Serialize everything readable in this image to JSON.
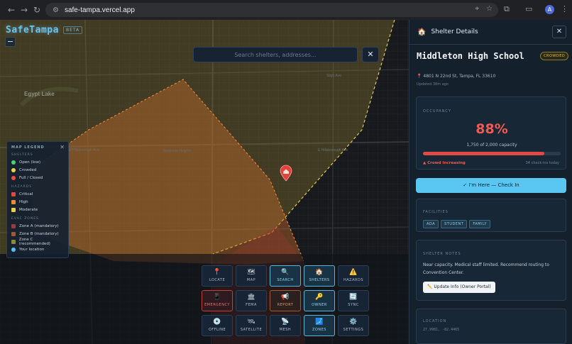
{
  "browser": {
    "url": "safe-tampa.vercel.app",
    "avatar_initial": "A"
  },
  "app": {
    "logo": "SafeTampa",
    "badge": "BETA"
  },
  "search": {
    "placeholder": "Search shelters, addresses...",
    "close": "✕"
  },
  "map": {
    "zoom_out": "−",
    "labels": {
      "egypt_lake": "Egypt Lake",
      "street_1": "W Hillsborough Ave",
      "street_2": "E Hillsborough Ave",
      "street_3": "Seminole Heights",
      "street_4": "Sligh Ave"
    }
  },
  "legend": {
    "title": "MAP LEGEND",
    "close": "✕",
    "shelters_title": "SHELTERS",
    "shelters": [
      {
        "label": "Open (low)",
        "color": "#4cd37a"
      },
      {
        "label": "Crowded",
        "color": "#e6d84a"
      },
      {
        "label": "Full / Closed",
        "color": "#ee4b4b"
      }
    ],
    "hazards_title": "HAZARDS",
    "hazards": [
      {
        "label": "Critical",
        "color": "#e04848"
      },
      {
        "label": "High",
        "color": "#e8893c"
      },
      {
        "label": "Moderate",
        "color": "#e6d24a"
      }
    ],
    "zones_title": "EVAC ZONES",
    "zones": [
      {
        "label": "Zone A (mandatory)",
        "color": "#9a3a3a"
      },
      {
        "label": "Zone B (mandatory)",
        "color": "#9a5a38"
      },
      {
        "label": "Zone C (recommended)",
        "color": "#8c8a3a"
      },
      {
        "label": "Your location",
        "color": "#4fc3f7"
      }
    ]
  },
  "toolbar": {
    "locate": "LOCATE",
    "map": "MAP",
    "search": "SEARCH",
    "shelters": "SHELTERS",
    "hazards": "HAZARDS",
    "emergency": "EMERGENCY",
    "fema": "FEMA",
    "report": "REPORT",
    "owner": "OWNER",
    "sync": "SYNC",
    "offline": "OFFLINE",
    "satellite": "SATELLITE",
    "mesh": "MESH",
    "zones": "ZONES",
    "settings": "SETTINGS"
  },
  "panel": {
    "title": "Shelter Details",
    "close": "✕",
    "shelter_name": "Middleton High School",
    "status_badge": "CROWDED",
    "address": "4801 N 22nd St, Tampa, FL 33610",
    "updated": "Updated 38m ago",
    "occupancy": {
      "title": "OCCUPANCY",
      "percent_text": "88%",
      "percent": 88,
      "capacity": "1,750 of 2,000 capacity",
      "trend": "▲ Crowd increasing",
      "checkins": "34 check-ins today"
    },
    "checkin_button": "✓ I'm Here — Check In",
    "facilities": {
      "title": "FACILITIES",
      "tags": [
        "ADA",
        "STUDENT",
        "FAMILY"
      ]
    },
    "notes": {
      "title": "SHELTER NOTES",
      "text": "Near capacity. Medical staff limited. Recommend routing to Convention Center.",
      "button": "✏️ Update Info (Owner Portal)"
    },
    "location": {
      "title": "LOCATION",
      "coords": "27.9981, -82.4465"
    }
  }
}
